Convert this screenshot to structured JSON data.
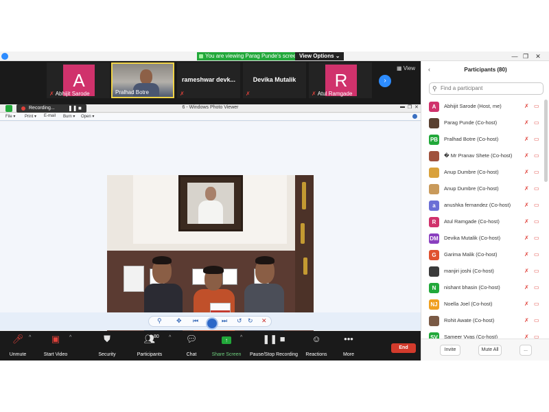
{
  "window": {
    "viewing_banner": "You are viewing Parag Punde's screen",
    "view_options": "View Options ⌄",
    "minimize": "—",
    "restore": "❐",
    "close": "✕"
  },
  "video_strip": {
    "tiles": [
      {
        "initial": "A",
        "name": "Abhijit Sarode",
        "avatar_color": "#d0326c"
      },
      {
        "name": "Pralhad Botre",
        "active": true
      },
      {
        "name": "rameshwar devk..."
      },
      {
        "name": "Devika Mutalik"
      },
      {
        "initial": "R",
        "name": "Atul Ramgade",
        "avatar_color": "#d0326c"
      }
    ],
    "view_label": "View"
  },
  "shared_window": {
    "recording_label": "Recording...",
    "title": "6 - Windows Photo Viewer",
    "menu": [
      "File ▾",
      "Print ▾",
      "E-mail",
      "Burn ▾",
      "Open ▾"
    ]
  },
  "controls": {
    "unmute": "Unmute",
    "start_video": "Start Video",
    "security": "Security",
    "participants": "Participants",
    "participants_count": "80",
    "chat": "Chat",
    "share_screen": "Share Screen",
    "pause_recording": "Pause/Stop Recording",
    "reactions": "Reactions",
    "more": "More",
    "end": "End"
  },
  "participants_panel": {
    "title": "Participants (80)",
    "search_placeholder": "Find a participant",
    "invite": "Invite",
    "mute_all": "Mute All",
    "more": "...",
    "list": [
      {
        "initials": "A",
        "color": "#d0326c",
        "name": "Abhijit Sarode (Host, me)"
      },
      {
        "initials": "",
        "color": "#5a4030",
        "name": "Parag Punde (Co-host)"
      },
      {
        "initials": "PB",
        "color": "#22a83a",
        "name": "Pralhad Botre (Co-host)"
      },
      {
        "initials": "",
        "color": "#a0523d",
        "name": "� Mr Pranav Shete (Co-host)"
      },
      {
        "initials": "",
        "color": "#d9a13b",
        "name": "Anup Dumbre (Co-host)"
      },
      {
        "initials": "",
        "color": "#c99a5b",
        "name": "Anup Dumbre (Co-host)"
      },
      {
        "initials": "a",
        "color": "#6b6fd6",
        "name": "anushka fernandez (Co-host)"
      },
      {
        "initials": "R",
        "color": "#d0326c",
        "name": "Atul Ramgade (Co-host)"
      },
      {
        "initials": "DM",
        "color": "#8a3fbf",
        "name": "Devika Mutalik (Co-host)"
      },
      {
        "initials": "G",
        "color": "#e0522f",
        "name": "Garima Malik (Co-host)"
      },
      {
        "initials": "",
        "color": "#3a3a3a",
        "name": "manjiri joshi (Co-host)"
      },
      {
        "initials": "N",
        "color": "#22a83a",
        "name": "nishant bhasin (Co-host)"
      },
      {
        "initials": "NJ",
        "color": "#f0a020",
        "name": "Noella Joel (Co-host)"
      },
      {
        "initials": "",
        "color": "#7a5a45",
        "name": "Rohit Awate (Co-host)"
      },
      {
        "initials": "SV",
        "color": "#22a83a",
        "name": "Sameer Vyas (Co-host)"
      }
    ]
  }
}
